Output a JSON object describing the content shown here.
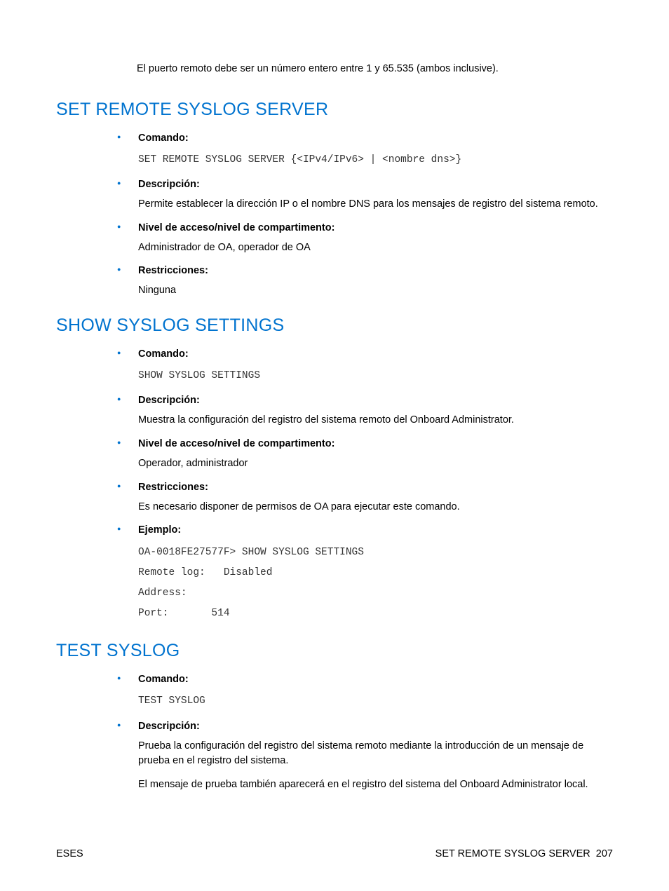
{
  "intro": "El puerto remoto debe ser un número entero entre 1 y 65.535 (ambos inclusive).",
  "sections": [
    {
      "title": "SET REMOTE SYSLOG SERVER",
      "items": [
        {
          "label": "Comando:",
          "mono": "SET REMOTE SYSLOG SERVER {<IPv4/IPv6> | <nombre dns>}"
        },
        {
          "label": "Descripción:",
          "text": "Permite establecer la dirección IP o el nombre DNS para los mensajes de registro del sistema remoto."
        },
        {
          "label": "Nivel de acceso/nivel de compartimento:",
          "text": "Administrador de OA, operador de OA"
        },
        {
          "label": "Restricciones:",
          "text": "Ninguna"
        }
      ]
    },
    {
      "title": "SHOW SYSLOG SETTINGS",
      "items": [
        {
          "label": "Comando:",
          "mono": "SHOW SYSLOG SETTINGS"
        },
        {
          "label": "Descripción:",
          "text": "Muestra la configuración del registro del sistema remoto del Onboard Administrator."
        },
        {
          "label": "Nivel de acceso/nivel de compartimento:",
          "text": "Operador, administrador"
        },
        {
          "label": "Restricciones:",
          "text": "Es necesario disponer de permisos de OA para ejecutar este comando."
        },
        {
          "label": "Ejemplo:",
          "monoBlock": "OA-0018FE27577F> SHOW SYSLOG SETTINGS\nRemote log:   Disabled\nAddress:\nPort:       514"
        }
      ]
    },
    {
      "title": "TEST SYSLOG",
      "items": [
        {
          "label": "Comando:",
          "mono": "TEST SYSLOG"
        },
        {
          "label": "Descripción:",
          "paragraphs": [
            "Prueba la configuración del registro del sistema remoto mediante la introducción de un mensaje de prueba en el registro del sistema.",
            "El mensaje de prueba también aparecerá en el registro del sistema del Onboard Administrator local."
          ]
        }
      ]
    }
  ],
  "footer": {
    "left": "ESES",
    "rightTitle": "SET REMOTE SYSLOG SERVER",
    "pageNum": "207"
  }
}
